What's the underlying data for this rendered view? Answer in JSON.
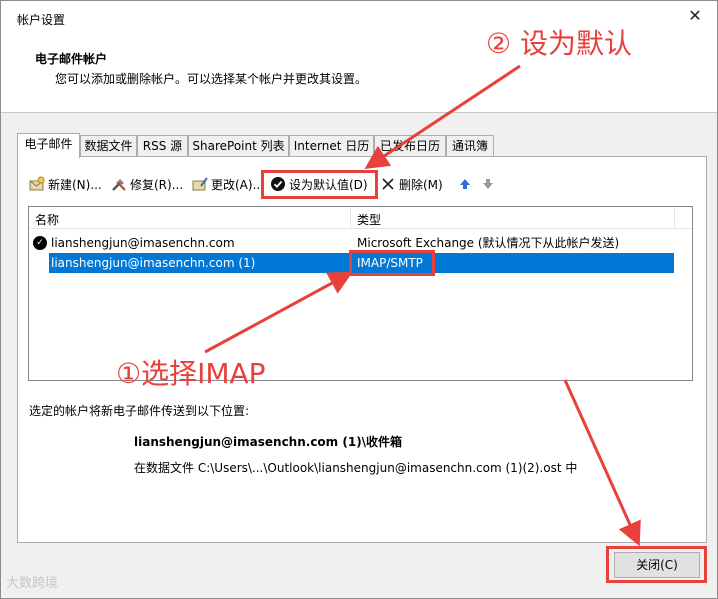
{
  "window": {
    "title": "帐户设置",
    "close_glyph": "✕"
  },
  "header": {
    "title": "电子邮件帐户",
    "description": "您可以添加或删除帐户。可以选择某个帐户并更改其设置。"
  },
  "tabs": [
    {
      "label": "电子邮件",
      "active": true
    },
    {
      "label": "数据文件"
    },
    {
      "label": "RSS 源"
    },
    {
      "label": "SharePoint 列表"
    },
    {
      "label": "Internet 日历"
    },
    {
      "label": "已发布日历"
    },
    {
      "label": "通讯簿"
    }
  ],
  "toolbar": {
    "new_label": "新建(N)...",
    "repair_label": "修复(R)...",
    "change_label": "更改(A)...",
    "set_default_label": "设为默认值(D)",
    "delete_label": "删除(M)",
    "new_icon": "new-account-icon",
    "repair_icon": "repair-tools-icon",
    "change_icon": "change-account-icon",
    "set_default_icon": "checkmark-circle-icon",
    "delete_icon": "x-icon",
    "move_up_icon": "up-arrow-icon",
    "move_down_icon": "down-arrow-icon"
  },
  "accounts": {
    "columns": [
      "名称",
      "类型"
    ],
    "rows": [
      {
        "name": "lianshengjun@imasenchn.com",
        "type": "Microsoft Exchange (默认情况下从此帐户发送)",
        "default": true
      },
      {
        "name": "lianshengjun@imasenchn.com (1)",
        "type": "IMAP/SMTP",
        "selected": true
      }
    ]
  },
  "delivery": {
    "label": "选定的帐户将新电子邮件传送到以下位置:",
    "target": "lianshengjun@imasenchn.com (1)\\收件箱",
    "path": "在数据文件 C:\\Users\\...\\Outlook\\lianshengjun@imasenchn.com (1)(2).ost 中"
  },
  "footer": {
    "close_label": "关闭(C)"
  },
  "annotations": {
    "step1": "①选择IMAP",
    "step2": "② 设为默认",
    "color": "#e8403a"
  },
  "watermark": "大数跨境"
}
